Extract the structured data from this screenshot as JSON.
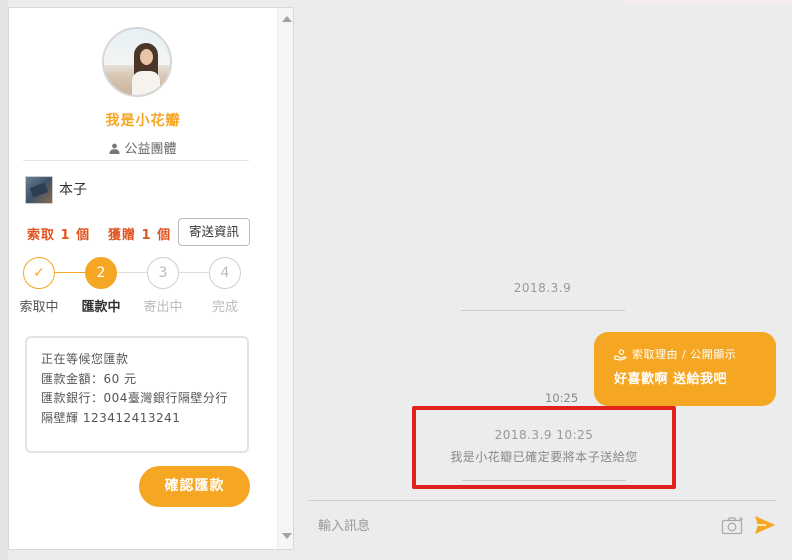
{
  "profile": {
    "name": "我是小花瓣",
    "type": "公益團體"
  },
  "item": {
    "name": "本子"
  },
  "stats": {
    "requested": "索取 1 個",
    "given": "獲贈 1 個",
    "send_info_label": "寄送資訊"
  },
  "steps": [
    {
      "num": "✓",
      "label": "索取中",
      "state": "done"
    },
    {
      "num": "2",
      "label": "匯款中",
      "state": "active"
    },
    {
      "num": "3",
      "label": "寄出中",
      "state": "todo"
    },
    {
      "num": "4",
      "label": "完成",
      "state": "todo"
    }
  ],
  "payment_info": {
    "line1": "正在等候您匯款",
    "line2": "匯款金額：60 元",
    "line3": "匯款銀行：004臺灣銀行隔壁分行",
    "line4": "隔壁輝 123412413241"
  },
  "confirm_label": "確認匯款",
  "chat": {
    "date_separator": "2018.3.9",
    "bubble": {
      "meta": "索取理由 / 公開顯示",
      "text": "好喜歡啊 送給我吧"
    },
    "message_time": "10:25",
    "system": {
      "datetime": "2018.3.9 10:25",
      "text": "我是小花瓣已確定要將本子送給您"
    },
    "input_placeholder": "輸入訊息"
  },
  "colors": {
    "accent": "#f5a623",
    "alert": "#e0541f",
    "highlight_box": "#e0211e"
  },
  "icons": [
    "person-icon",
    "camera-icon",
    "send-icon",
    "hand-icon",
    "check-icon"
  ]
}
